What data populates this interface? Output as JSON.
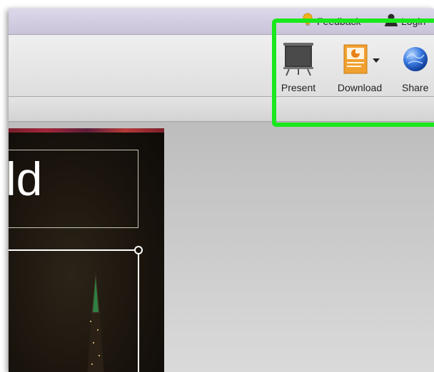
{
  "topbar": {
    "feedback_label": "Feedback",
    "login_label": "Login"
  },
  "toolbar": {
    "present_label": "Present",
    "download_label": "Download",
    "share_label": "Share"
  },
  "slide": {
    "title_fragment": "ld"
  },
  "colors": {
    "highlight": "#19e81d",
    "topbar": "#d6d1e3",
    "workspace": "#c9c9c9",
    "slide_bg": "#1a140d"
  },
  "icons": [
    "lightbulb-icon",
    "user-icon",
    "projector-screen-icon",
    "powerpoint-file-icon",
    "dropdown-arrow-icon",
    "globe-icon"
  ]
}
